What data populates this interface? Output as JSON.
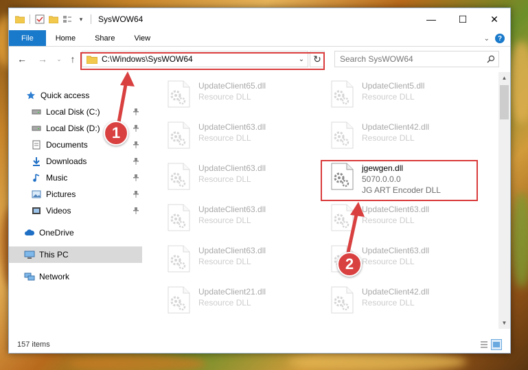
{
  "window": {
    "title": "SysWOW64",
    "controls": {
      "minimize": "—",
      "maximize": "☐",
      "close": "✕"
    }
  },
  "ribbon": {
    "tabs": [
      "File",
      "Home",
      "Share",
      "View"
    ]
  },
  "navigation": {
    "address": "C:\\Windows\\SysWOW64",
    "search_placeholder": "Search SysWOW64"
  },
  "sidebar": {
    "items": [
      {
        "label": "Quick access",
        "icon": "star-icon",
        "pinned": false
      },
      {
        "label": "Local Disk (C:)",
        "icon": "drive-icon",
        "pinned": true
      },
      {
        "label": "Local Disk (D:)",
        "icon": "drive-icon",
        "pinned": true
      },
      {
        "label": "Documents",
        "icon": "documents-icon",
        "pinned": true
      },
      {
        "label": "Downloads",
        "icon": "download-icon",
        "pinned": true
      },
      {
        "label": "Music",
        "icon": "music-icon",
        "pinned": true
      },
      {
        "label": "Pictures",
        "icon": "pictures-icon",
        "pinned": true
      },
      {
        "label": "Videos",
        "icon": "videos-icon",
        "pinned": true
      },
      {
        "label": "OneDrive",
        "icon": "cloud-icon",
        "pinned": false
      },
      {
        "label": "This PC",
        "icon": "computer-icon",
        "pinned": false,
        "selected": true
      },
      {
        "label": "Network",
        "icon": "network-icon",
        "pinned": false
      }
    ]
  },
  "files": [
    {
      "name": "UpdateClient65.dll",
      "type": "Resource DLL",
      "faded": true
    },
    {
      "name": "UpdateClient5.dll",
      "type": "Resource DLL",
      "faded": true
    },
    {
      "name": "UpdateClient63.dll",
      "type": "Resource DLL",
      "faded": true
    },
    {
      "name": "UpdateClient42.dll",
      "type": "Resource DLL",
      "faded": true
    },
    {
      "name": "UpdateClient63.dll",
      "type": "Resource DLL",
      "faded": true
    },
    {
      "name": "jgewgen.dll",
      "version": "5070.0.0.0",
      "type": "JG ART Encoder DLL",
      "faded": false,
      "highlighted": true
    },
    {
      "name": "UpdateClient63.dll",
      "type": "Resource DLL",
      "faded": true
    },
    {
      "name": "UpdateClient63.dll",
      "type": "Resource DLL",
      "faded": true
    },
    {
      "name": "UpdateClient63.dll",
      "type": "Resource DLL",
      "faded": true
    },
    {
      "name": "UpdateClient63.dll",
      "type": "Resource DLL",
      "faded": true
    },
    {
      "name": "UpdateClient21.dll",
      "type": "Resource DLL",
      "faded": true
    },
    {
      "name": "UpdateClient42.dll",
      "type": "Resource DLL",
      "faded": true
    }
  ],
  "status": {
    "item_count": "157 items"
  },
  "annotations": {
    "badge_1": "1",
    "badge_2": "2",
    "highlight_color": "#d93a3a"
  }
}
